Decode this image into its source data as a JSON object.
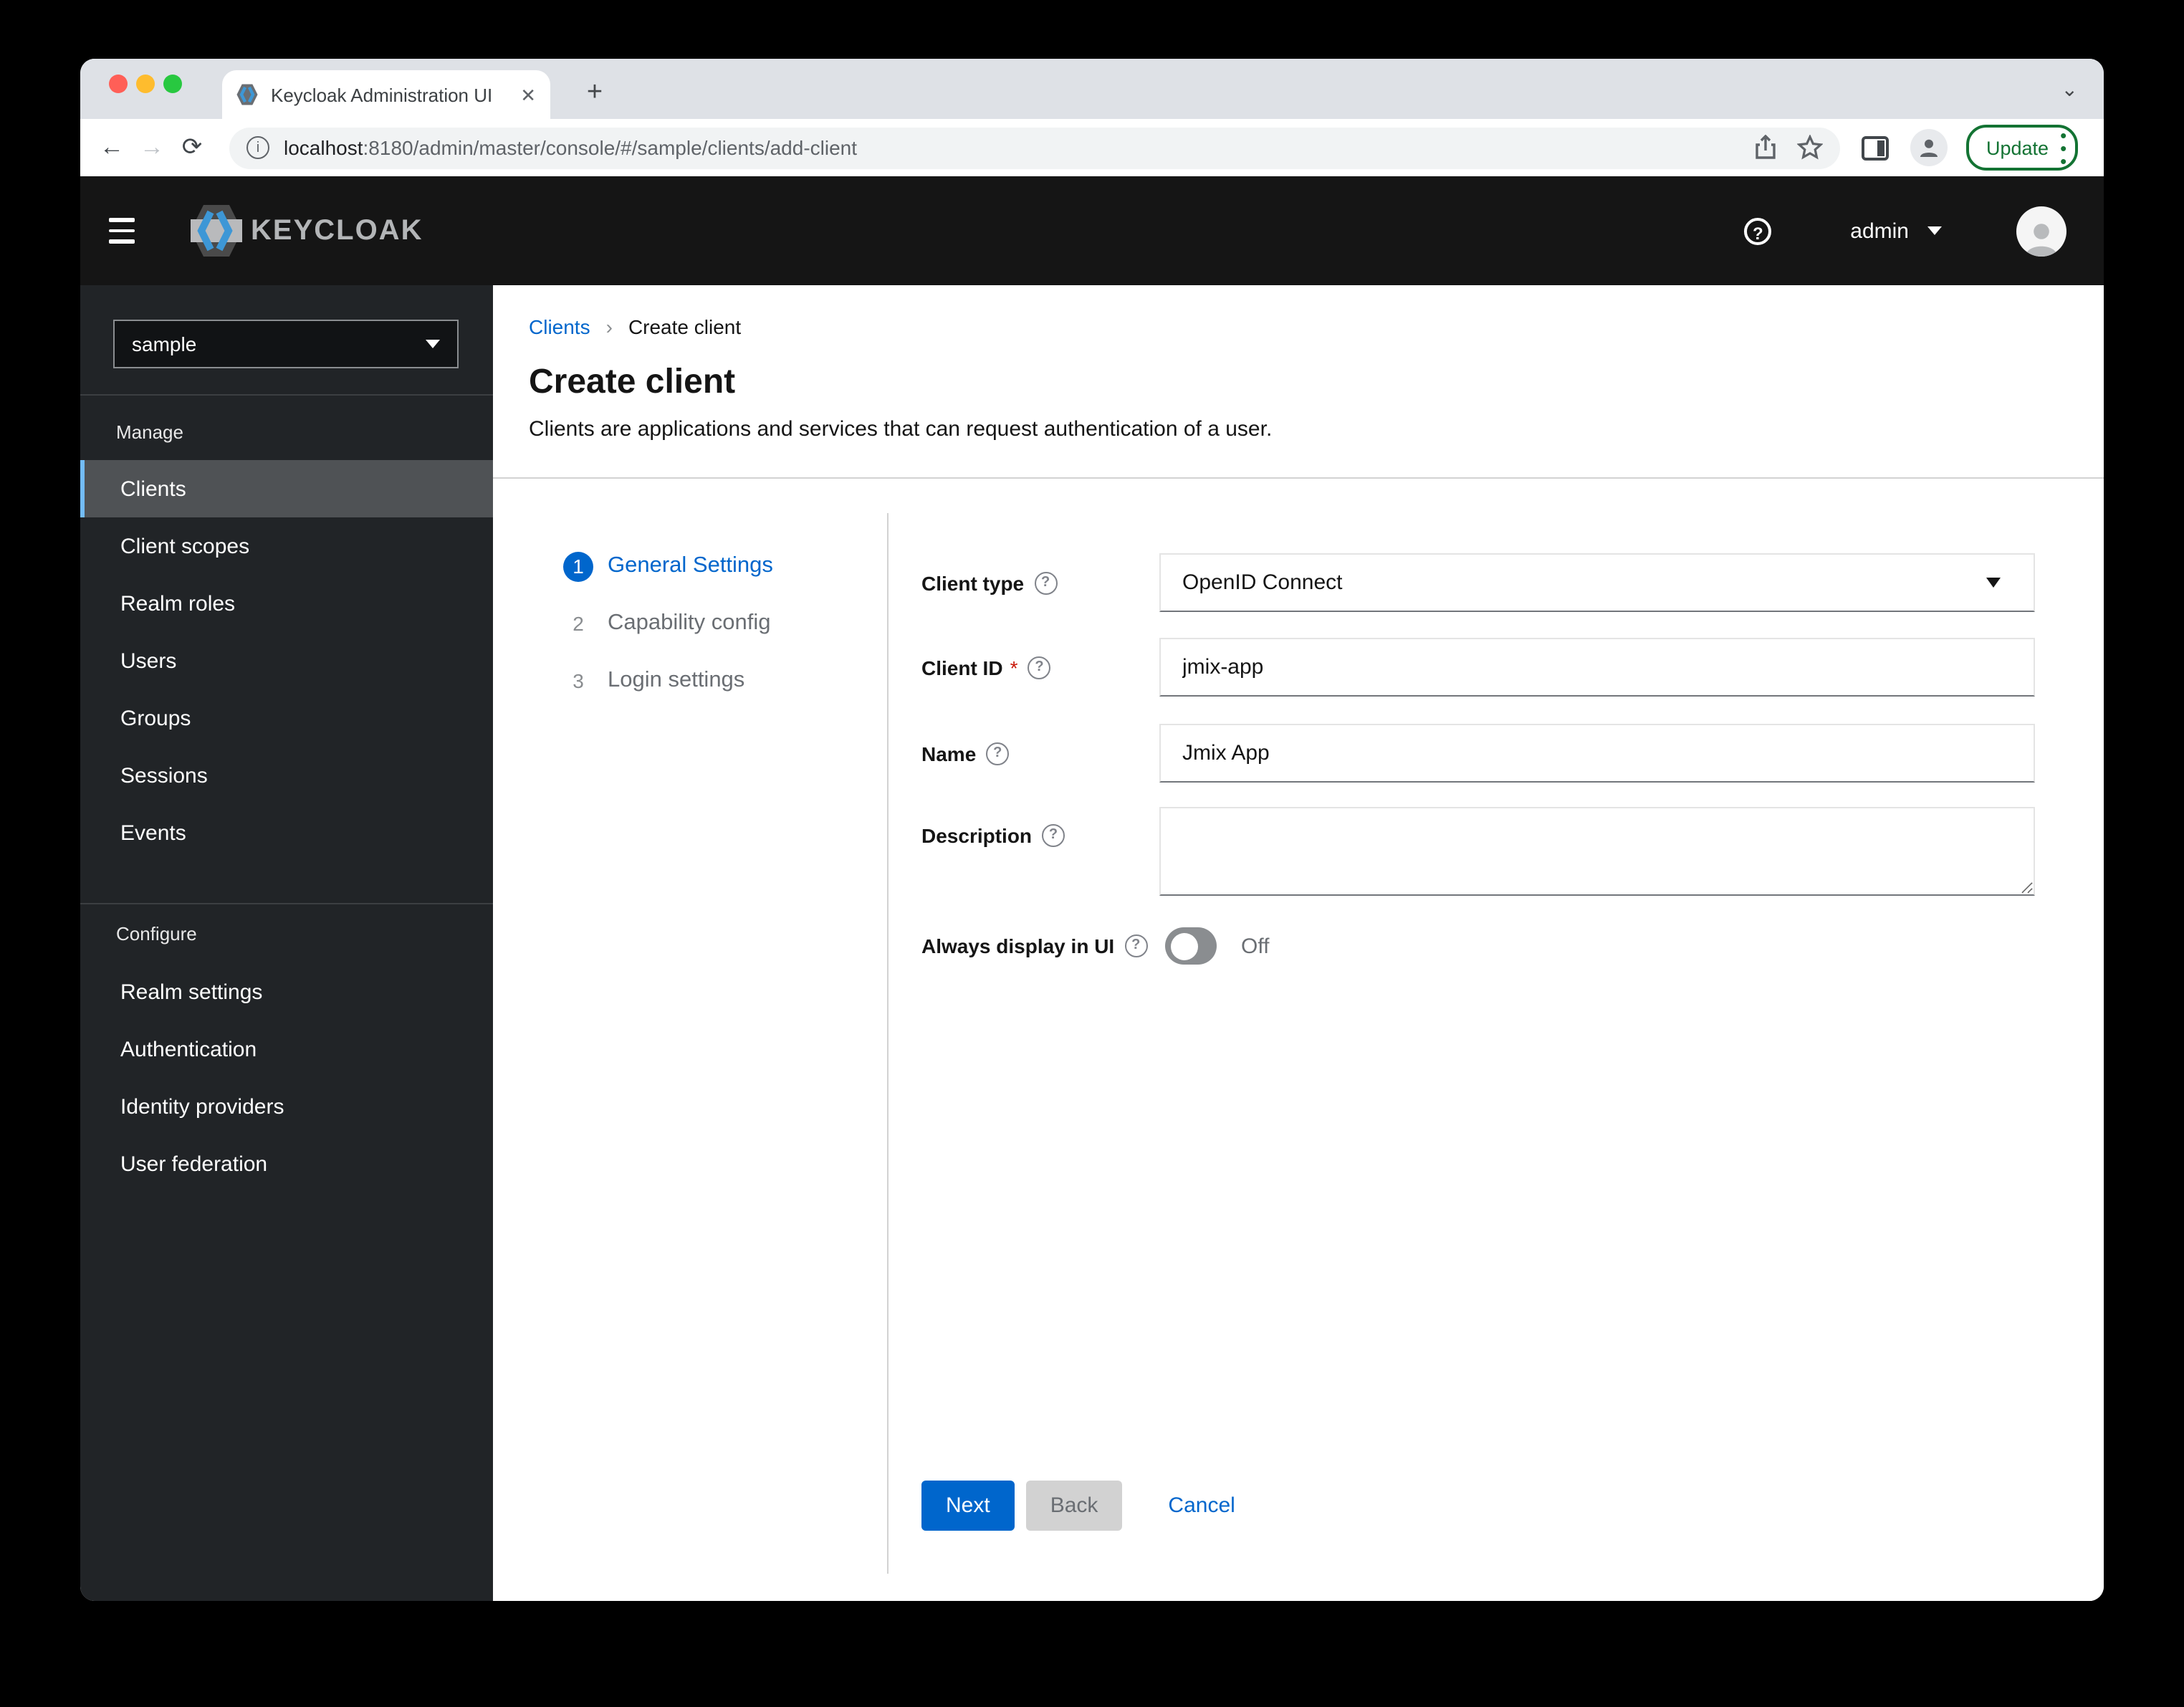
{
  "browser": {
    "tab_title": "Keycloak Administration UI",
    "url_host": "localhost",
    "url_rest": ":8180/admin/master/console/#/sample/clients/add-client",
    "update_label": "Update"
  },
  "header": {
    "brand": "KEYCLOAK",
    "username": "admin"
  },
  "sidebar": {
    "realm": "sample",
    "selected_item": "Clients",
    "sections": [
      {
        "label": "Manage",
        "items": [
          "Clients",
          "Client scopes",
          "Realm roles",
          "Users",
          "Groups",
          "Sessions",
          "Events"
        ]
      },
      {
        "label": "Configure",
        "items": [
          "Realm settings",
          "Authentication",
          "Identity providers",
          "User federation"
        ]
      }
    ]
  },
  "main": {
    "breadcrumb": {
      "link": "Clients",
      "current": "Create client"
    },
    "title": "Create client",
    "subtitle": "Clients are applications and services that can request authentication of a user.",
    "steps": [
      {
        "num": "1",
        "label": "General Settings"
      },
      {
        "num": "2",
        "label": "Capability config"
      },
      {
        "num": "3",
        "label": "Login settings"
      }
    ],
    "form": {
      "client_type": {
        "label": "Client type",
        "value": "OpenID Connect"
      },
      "client_id": {
        "label": "Client ID",
        "required": "*",
        "value": "jmix-app"
      },
      "name": {
        "label": "Name",
        "value": "Jmix App"
      },
      "description": {
        "label": "Description",
        "value": ""
      },
      "always_display": {
        "label": "Always display in UI",
        "state": "Off"
      }
    },
    "buttons": {
      "next": "Next",
      "back": "Back",
      "cancel": "Cancel"
    }
  },
  "colors": {
    "primary": "#0066cc",
    "nav_selected_bg": "#4f5255",
    "nav_accent": "#73bcf7",
    "update_green": "#137333"
  }
}
